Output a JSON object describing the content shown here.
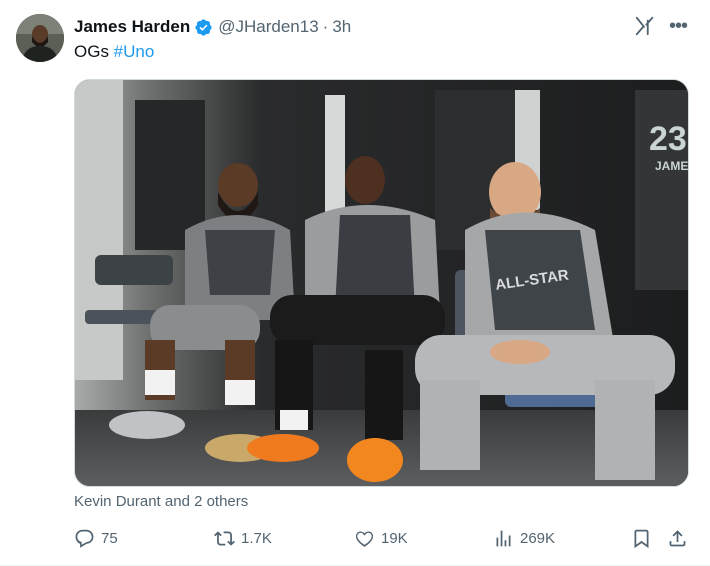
{
  "author": {
    "name": "James Harden",
    "handle": "@JHarden13",
    "separator": "·",
    "time": "3h",
    "verified": true
  },
  "tweet": {
    "text_prefix": "OGs ",
    "hashtag": "#Uno"
  },
  "media": {
    "tagged_text": "Kevin Durant and 2 others",
    "jersey_number": "23",
    "jersey_name": "JAME",
    "shirt_text": "ALL-STAR"
  },
  "actions": {
    "replies": "75",
    "reposts": "1.7K",
    "likes": "19K",
    "views": "269K"
  },
  "icons": {
    "verified": "verified-badge-icon",
    "grok": "grok-icon",
    "more": "more-icon",
    "reply": "reply-icon",
    "repost": "repost-icon",
    "like": "heart-icon",
    "views": "views-icon",
    "bookmark": "bookmark-icon",
    "share": "share-icon"
  },
  "colors": {
    "link": "#1d9bf0",
    "secondary_text": "#536471",
    "verified": "#1d9bf0"
  }
}
